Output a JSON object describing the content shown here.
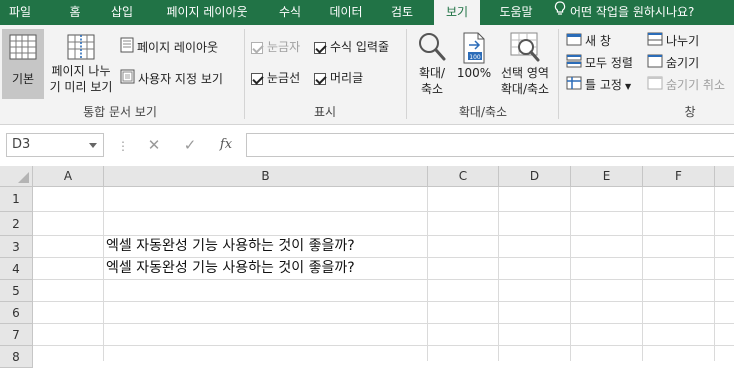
{
  "tabs": [
    {
      "label": "파일"
    },
    {
      "label": "홈"
    },
    {
      "label": "삽입"
    },
    {
      "label": "페이지 레이아웃"
    },
    {
      "label": "수식"
    },
    {
      "label": "데이터"
    },
    {
      "label": "검토"
    },
    {
      "label": "보기"
    },
    {
      "label": "도움말"
    },
    {
      "label": "어떤 작업을 원하시나요?"
    }
  ],
  "ribbon": {
    "workbook_views": {
      "group_label": "통합 문서 보기",
      "normal": "기본",
      "page_break_line1": "페이지 나누",
      "page_break_line2": "기 미리 보기",
      "page_layout": "페이지 레이아웃",
      "custom_views": "사용자 지정 보기"
    },
    "show": {
      "group_label": "표시",
      "ruler": "눈금자",
      "formula_bar": "수식 입력줄",
      "gridlines": "눈금선",
      "headings": "머리글"
    },
    "zoom": {
      "group_label": "확대/축소",
      "zoom_line1": "확대/",
      "zoom_line2": "축소",
      "zoom100": "100%",
      "selection_line1": "선택 영역",
      "selection_line2": "확대/축소"
    },
    "window": {
      "group_label": "창",
      "new_window": "새 창",
      "arrange_all": "모두 정렬",
      "freeze_panes": "틀 고정",
      "split": "나누기",
      "hide": "숨기기",
      "unhide": "숨기기 취소"
    }
  },
  "formula_bar": {
    "name_box": "D3",
    "fx": "fx",
    "content": ""
  },
  "columns": [
    "A",
    "B",
    "C",
    "D",
    "E",
    "F"
  ],
  "rows": [
    "1",
    "2",
    "3",
    "4",
    "5",
    "6",
    "7",
    "8"
  ],
  "cells": {
    "B3": "엑셀 자동완성 기능 사용하는 것이 좋을까?",
    "B4": "엑셀 자동완성 기능 사용하는 것이 좋을까?"
  },
  "colors": {
    "accent": "#217346",
    "ribbon_bg": "#f3f3f3"
  }
}
